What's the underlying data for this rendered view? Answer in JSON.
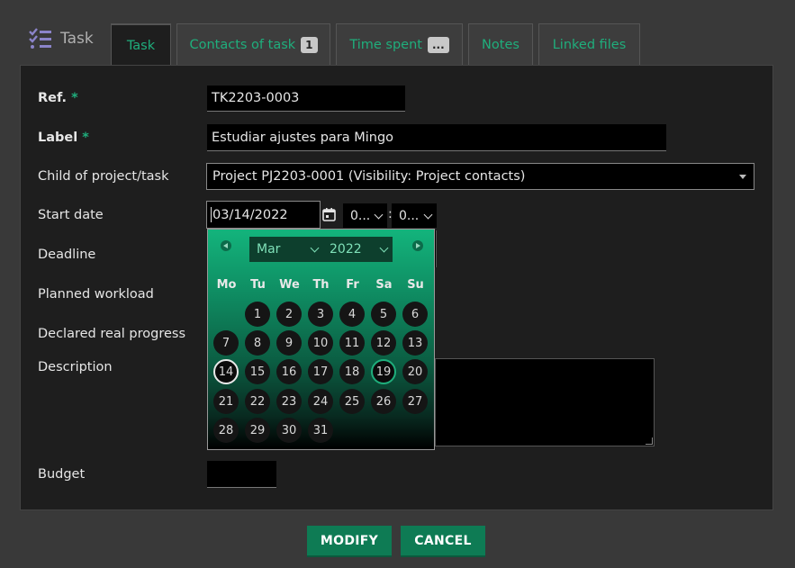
{
  "header": {
    "brand": {
      "icon": "tasks-list-icon",
      "label": "Task"
    },
    "tabs": [
      {
        "label": "Task",
        "active": true
      },
      {
        "label": "Contacts of task",
        "badge": "1"
      },
      {
        "label": "Time spent",
        "badge": "..."
      },
      {
        "label": "Notes"
      },
      {
        "label": "Linked files"
      }
    ]
  },
  "form": {
    "ref": {
      "label": "Ref.",
      "required": "*",
      "value": "TK2203-0003"
    },
    "task_label": {
      "label": "Label",
      "required": "*",
      "value": "Estudiar ajustes para Mingo"
    },
    "parent": {
      "label": "Child of project/task",
      "value": "Project PJ2203-0001 (Visibility: Project contacts)"
    },
    "start_date": {
      "label": "Start date",
      "value": "03/14/2022",
      "hour": "0...",
      "sep": ":",
      "minute": "0..."
    },
    "deadline": {
      "label": "Deadline"
    },
    "planned_workload": {
      "label": "Planned workload"
    },
    "progress": {
      "label": "Declared real progress"
    },
    "description": {
      "label": "Description"
    },
    "budget": {
      "label": "Budget"
    }
  },
  "datepicker": {
    "month": "Mar",
    "year": "2022",
    "weekdays": [
      "Mo",
      "Tu",
      "We",
      "Th",
      "Fr",
      "Sa",
      "Su"
    ],
    "days": [
      "1",
      "2",
      "3",
      "4",
      "5",
      "6",
      "7",
      "8",
      "9",
      "10",
      "11",
      "12",
      "13",
      "14",
      "15",
      "16",
      "17",
      "18",
      "19",
      "20",
      "21",
      "22",
      "23",
      "24",
      "25",
      "26",
      "27",
      "28",
      "29",
      "30",
      "31"
    ],
    "first_weekday_index": 1,
    "selected_day": "14",
    "highlighted_day": "19"
  },
  "actions": {
    "modify": "MODIFY",
    "cancel": "CANCEL"
  },
  "colors": {
    "accent": "#1fae7c",
    "button": "#0e7b54",
    "panel": "#1e1e1e",
    "page": "#393939"
  }
}
